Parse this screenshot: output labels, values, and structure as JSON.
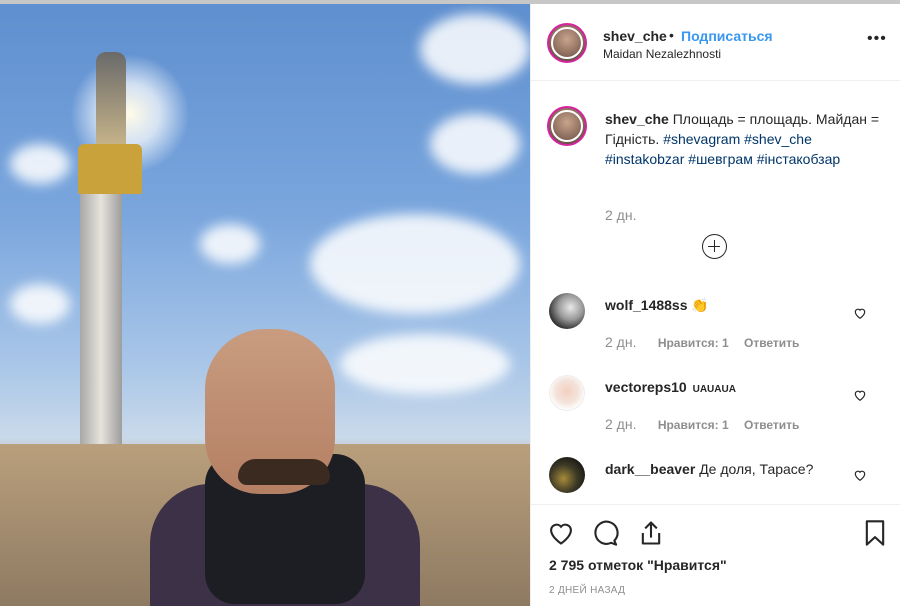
{
  "post": {
    "username": "shev_che",
    "dot": "•",
    "follow_label": "Подписаться",
    "location": "Maidan Nezalezhnosti",
    "more_label": "•••",
    "caption_text": "Площадь = площадь. Майдан = Гідність.",
    "hashtags": [
      "#shevagram",
      "#shev_che",
      "#instakobzar",
      "#шевграм",
      "#інстакобзар"
    ],
    "caption_time": "2 дн."
  },
  "comments": [
    {
      "user": "wolf_1488ss",
      "text": "👏",
      "time": "2 дн.",
      "likes": "Нравится: 1",
      "reply": "Ответить"
    },
    {
      "user": "vectoreps10",
      "text": "UAUAUA",
      "time": "2 дн.",
      "likes": "Нравится: 1",
      "reply": "Ответить"
    },
    {
      "user": "dark__beaver",
      "text": "Де доля, Тарасе?",
      "time": "",
      "likes": "",
      "reply": ""
    }
  ],
  "footer": {
    "likes_count": "2 795",
    "likes_label": "отметок \"Нравится\"",
    "posted_ago": "2 ДНЕЙ НАЗАД"
  },
  "colors": {
    "accent": "#3897f0",
    "hashtag": "#003569",
    "muted": "#8e8e8e"
  }
}
